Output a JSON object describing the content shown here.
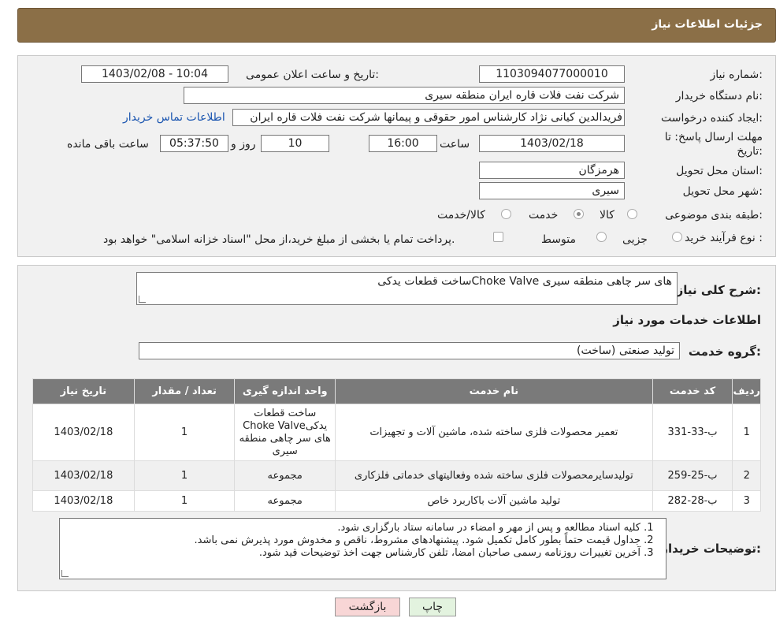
{
  "header": {
    "title": "جزئیات اطلاعات نیاز"
  },
  "info": {
    "need_number_label": "شماره نیاز:",
    "need_number": "1103094077000010",
    "announce_label": "تاریخ و ساعت اعلان عمومی:",
    "announce_value": "1403/02/08 - 10:04",
    "buyer_org_label": "نام دستگاه خریدار:",
    "buyer_org": "شرکت نفت فلات قاره ایران منطقه سیری",
    "creator_label": "ایجاد کننده درخواست:",
    "creator": "فریدالدین کیانی نژاد کارشناس امور حقوقی و پیمانها شرکت نفت فلات قاره ایران",
    "contact_link": "اطلاعات تماس خریدار",
    "deadline_label": "مهلت ارسال پاسخ: تا تاریخ:",
    "deadline_date": "1403/02/18",
    "time_label": "ساعت",
    "deadline_time": "16:00",
    "days_value": "10",
    "days_label": "روز و",
    "remaining_time": "05:37:50",
    "remaining_label": "ساعت باقی مانده",
    "province_label": "استان محل تحویل:",
    "province": "هرمزگان",
    "city_label": "شهر محل تحویل:",
    "city": "سیری",
    "category_label": "طبقه بندی موضوعی:",
    "category_options": [
      "کالا",
      "خدمت",
      "کالا/خدمت"
    ],
    "category_selected": "خدمت",
    "process_label": "نوع فرآیند خرید :",
    "process_options": [
      "جزیی",
      "متوسط"
    ],
    "payment_note": "پرداخت تمام یا بخشی از مبلغ خرید،از محل \"اسناد خزانه اسلامی\" خواهد بود."
  },
  "details": {
    "summary_label": "شرح کلی نیاز:",
    "summary": "ساخت قطعات یدکیChoke Valve  های سر چاهی منطقه سیری",
    "services_title": "اطلاعات خدمات مورد نیاز",
    "group_label": "گروه خدمت:",
    "group_value": "تولید صنعتی (ساخت)",
    "table": {
      "headers": [
        "ردیف",
        "کد خدمت",
        "نام خدمت",
        "واحد اندازه گیری",
        "تعداد / مقدار",
        "تاریخ نیاز"
      ],
      "rows": [
        [
          "1",
          "ب-33-331",
          "تعمیر محصولات فلزی ساخته شده، ماشین آلات و تجهیزات",
          "ساخت قطعات یدکیChoke Valve های سر چاهی منطقه سیری",
          "1",
          "1403/02/18"
        ],
        [
          "2",
          "ب-25-259",
          "تولیدسایرمحصولات فلزی ساخته شده وفعالیتهای خدماتی فلزکاری",
          "مجموعه",
          "1",
          "1403/02/18"
        ],
        [
          "3",
          "ب-28-282",
          "تولید ماشین آلات باکاربرد خاص",
          "مجموعه",
          "1",
          "1403/02/18"
        ]
      ]
    },
    "buyer_notes_label": "توضیحات خریدار:",
    "buyer_notes": [
      "کلیه اسناد مطالعه و پس از مهر و امضاء در سامانه ستاد بارگزاری شود.",
      "جداول قیمت حتماً بطور کامل تکمیل شود. پیشنهادهای مشروط، ناقص و مخدوش مورد پذیرش نمی باشد.",
      "آخرین تغییرات روزنامه رسمی صاحبان امضا، تلفن کارشناس جهت اخذ توضیحات قید شود."
    ]
  },
  "buttons": {
    "print": "چاپ",
    "back": "بازگشت"
  },
  "colors": {
    "header_bg": "#8b6f47",
    "back_button_bg": "#f8d6d6",
    "print_button_bg": "#e3f3df",
    "link": "#1a55b0"
  }
}
